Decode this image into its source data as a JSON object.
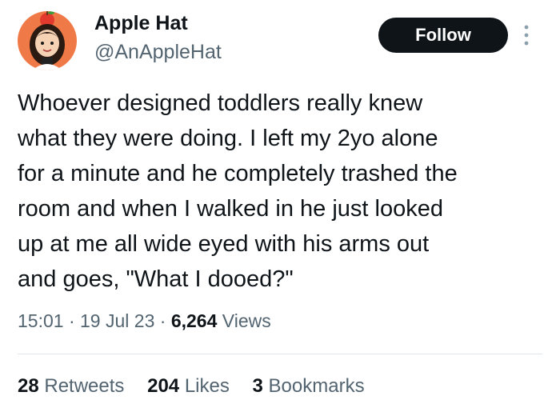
{
  "user": {
    "display_name": "Apple Hat",
    "handle": "@AnAppleHat",
    "avatar_icon": "cartoon-girl-with-apple-hat-avatar"
  },
  "actions": {
    "follow_label": "Follow",
    "more_icon": "vertical-ellipsis-icon"
  },
  "tweet": {
    "text": "Whoever designed toddlers really knew\nwhat they were doing. I left my 2yo alone\nfor a minute and he completely trashed the\nroom and when I walked in he just looked\nup at me all wide eyed with his arms out\nand goes, \"What I dooed?\""
  },
  "meta": {
    "time": "15:01",
    "separator": "·",
    "date": "19 Jul 23",
    "views_count": "6,264",
    "views_label": "Views"
  },
  "stats": {
    "retweets_count": "28",
    "retweets_label": "Retweets",
    "likes_count": "204",
    "likes_label": "Likes",
    "bookmarks_count": "3",
    "bookmarks_label": "Bookmarks"
  },
  "colors": {
    "text_primary": "#0f1419",
    "text_secondary": "#536471",
    "follow_bg": "#0f1419",
    "divider": "#e1e8ed",
    "avatar_bg": "#f07a47"
  }
}
